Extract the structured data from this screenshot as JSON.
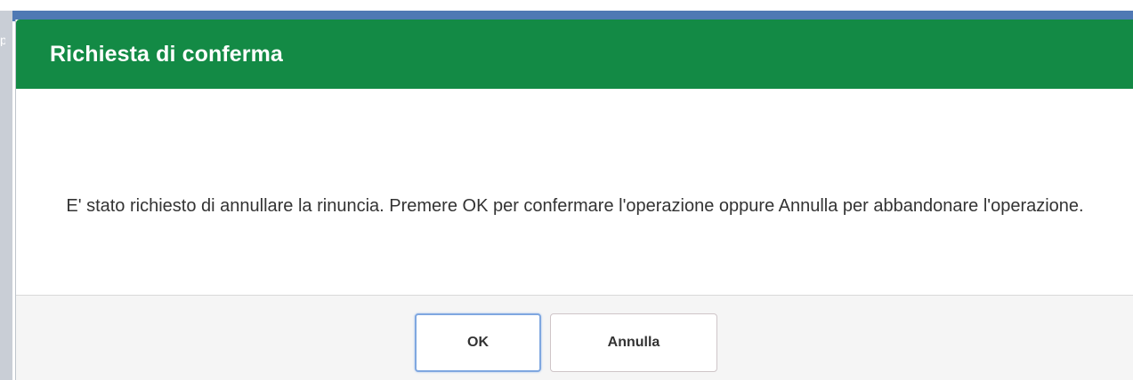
{
  "dialog": {
    "title": "Richiesta di conferma",
    "message": "E' stato richiesto di annullare la rinuncia. Premere OK per confermare l'operazione oppure Annulla per abbandonare l'operazione.",
    "ok_label": "OK",
    "cancel_label": "Annulla"
  },
  "background": {
    "partial_text": "p"
  },
  "colors": {
    "header": "#138a45",
    "header_text": "#ffffff",
    "app_bar": "#4f79b4",
    "footer": "#f5f5f5",
    "ok_focus_border": "#7fa7e0"
  }
}
